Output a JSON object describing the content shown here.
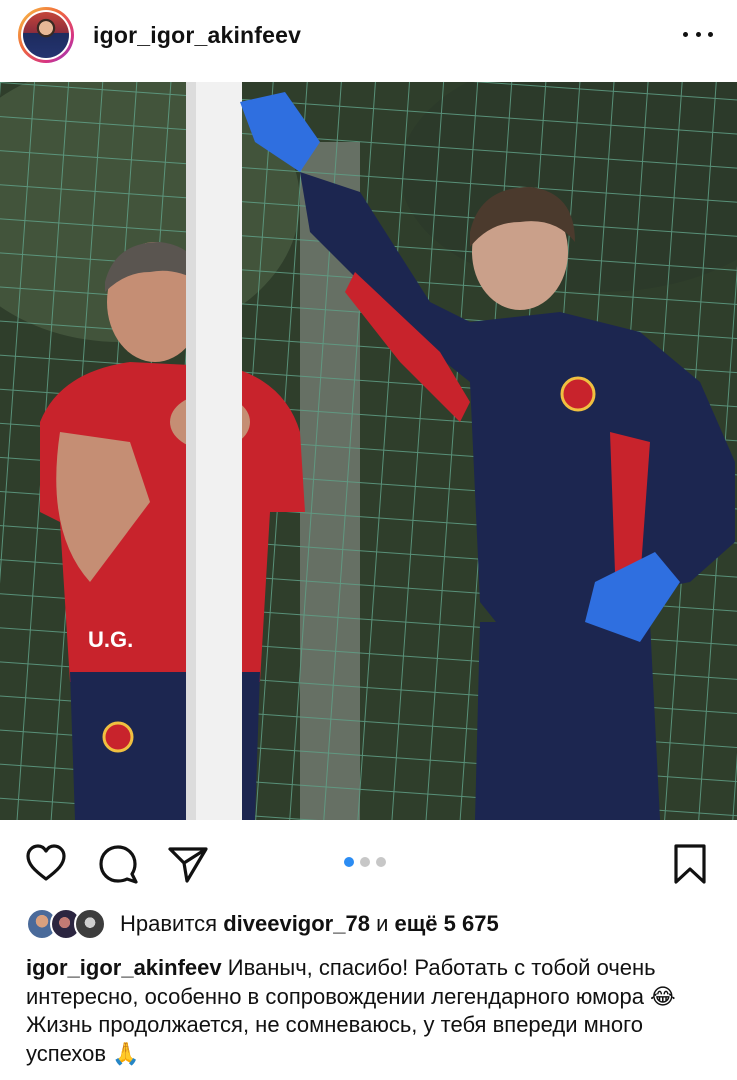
{
  "post": {
    "username": "igor_igor_akinfeev",
    "more_icon": "ellipsis-icon"
  },
  "photo": {
    "jersey_initials": "U.G."
  },
  "actions": {
    "like_icon": "heart-icon",
    "comment_icon": "comment-icon",
    "share_icon": "send-icon",
    "save_icon": "bookmark-icon",
    "carousel_total": 3,
    "carousel_active": 1
  },
  "likes": {
    "prefix": "Нравится",
    "liker": "diveevigor_78",
    "middle": "и",
    "others": "ещё 5 675"
  },
  "caption": {
    "username": "igor_igor_akinfeev",
    "text": "Иваныч, спасибо! Работать с тобой очень интересно, особенно в сопровождении легендарного юмора 😂 Жизнь продолжается, не сомневаюсь, у тебя впереди много успехов 🙏"
  },
  "colors": {
    "accent": "#2b8cf3",
    "jersey_red": "#c8232c",
    "jersey_navy": "#1c2650",
    "glove_blue": "#2f6fe0"
  }
}
